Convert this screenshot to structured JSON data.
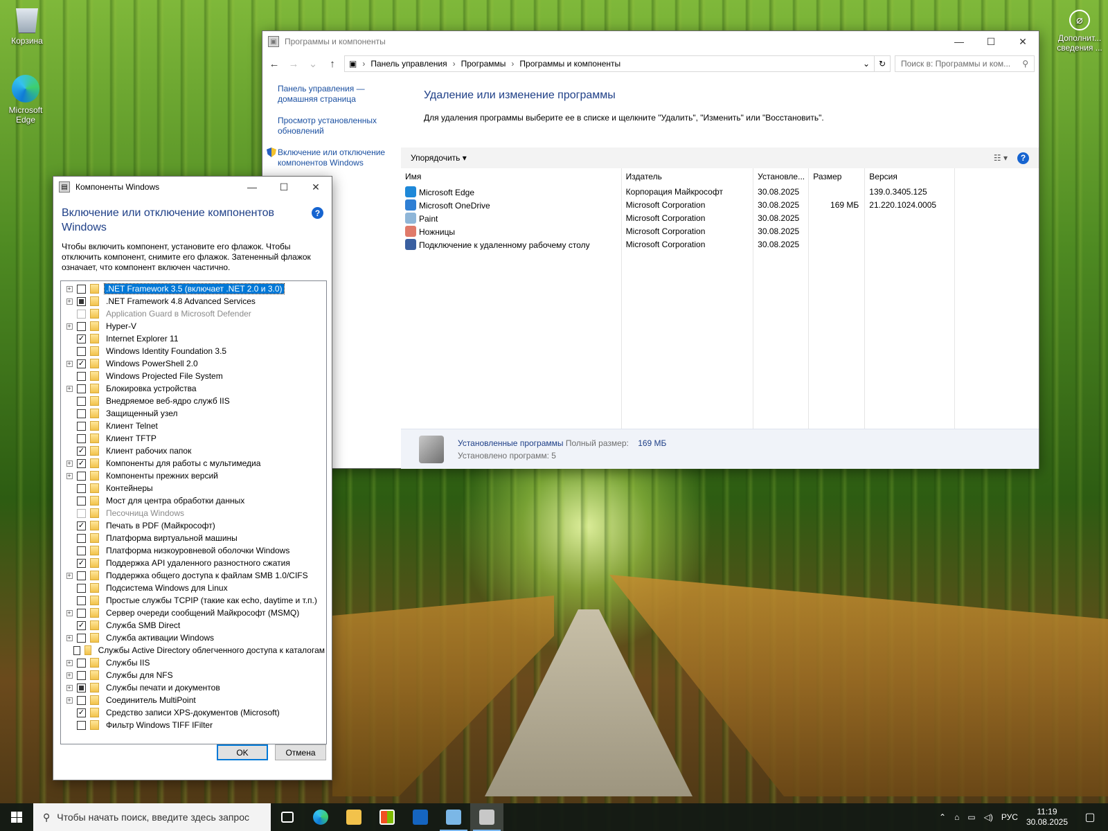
{
  "desktop": {
    "icons": [
      {
        "label": "Корзина",
        "icon": "recycle-bin-icon"
      },
      {
        "label": "Microsoft Edge",
        "icon": "edge-icon"
      }
    ],
    "right_icon": {
      "label": "Дополнит... сведения ..."
    }
  },
  "programs_window": {
    "title": "Программы и компоненты",
    "breadcrumb": [
      "Панель управления",
      "Программы",
      "Программы и компоненты"
    ],
    "search_placeholder": "Поиск в: Программы и ком...",
    "left_links": [
      "Панель управления — домашняя страница",
      "Просмотр установленных обновлений",
      "Включение или отключение компонентов Windows"
    ],
    "heading": "Удаление или изменение программы",
    "description": "Для удаления программы выберите ее в списке и щелкните \"Удалить\", \"Изменить\" или \"Восстановить\".",
    "organize_label": "Упорядочить",
    "columns": [
      "Имя",
      "Издатель",
      "Установле...",
      "Размер",
      "Версия"
    ],
    "programs": [
      {
        "name": "Microsoft Edge",
        "publisher": "Корпорация Майкрософт",
        "installed": "30.08.2025",
        "size": "",
        "version": "139.0.3405.125",
        "icon_color": "#1e88d8"
      },
      {
        "name": "Microsoft OneDrive",
        "publisher": "Microsoft Corporation",
        "installed": "30.08.2025",
        "size": "169 МБ",
        "version": "21.220.1024.0005",
        "icon_color": "#2f7fd4"
      },
      {
        "name": "Paint",
        "publisher": "Microsoft Corporation",
        "installed": "30.08.2025",
        "size": "",
        "version": "",
        "icon_color": "#8fb6d8"
      },
      {
        "name": "Ножницы",
        "publisher": "Microsoft Corporation",
        "installed": "30.08.2025",
        "size": "",
        "version": "",
        "icon_color": "#e07a6a"
      },
      {
        "name": "Подключение к удаленному рабочему столу",
        "publisher": "Microsoft Corporation",
        "installed": "30.08.2025",
        "size": "",
        "version": "",
        "icon_color": "#3a5fa0"
      }
    ],
    "status": {
      "installed_label": "Установленные программы",
      "total_size_label": "Полный размер:",
      "total_size": "169 МБ",
      "count_text": "Установлено программ: 5"
    }
  },
  "components_dialog": {
    "title": "Компоненты Windows",
    "heading": "Включение или отключение компонентов Windows",
    "description": "Чтобы включить компонент, установите его флажок. Чтобы отключить компонент, снимите его флажок. Затененный флажок означает, что компонент включен частично.",
    "items": [
      {
        "label": ".NET Framework 3.5 (включает .NET 2.0 и 3.0)",
        "state": "unchecked",
        "expandable": true,
        "selected": true,
        "disabled": false
      },
      {
        "label": ".NET Framework 4.8 Advanced Services",
        "state": "partial",
        "expandable": true,
        "selected": false,
        "disabled": false
      },
      {
        "label": "Application Guard в Microsoft Defender",
        "state": "unchecked",
        "expandable": false,
        "selected": false,
        "disabled": true
      },
      {
        "label": "Hyper-V",
        "state": "unchecked",
        "expandable": true,
        "selected": false,
        "disabled": false
      },
      {
        "label": "Internet Explorer 11",
        "state": "checked",
        "expandable": false,
        "selected": false,
        "disabled": false
      },
      {
        "label": "Windows Identity Foundation 3.5",
        "state": "unchecked",
        "expandable": false,
        "selected": false,
        "disabled": false
      },
      {
        "label": "Windows PowerShell 2.0",
        "state": "checked",
        "expandable": true,
        "selected": false,
        "disabled": false
      },
      {
        "label": "Windows Projected File System",
        "state": "unchecked",
        "expandable": false,
        "selected": false,
        "disabled": false
      },
      {
        "label": "Блокировка устройства",
        "state": "unchecked",
        "expandable": true,
        "selected": false,
        "disabled": false
      },
      {
        "label": "Внедряемое веб-ядро служб IIS",
        "state": "unchecked",
        "expandable": false,
        "selected": false,
        "disabled": false
      },
      {
        "label": "Защищенный узел",
        "state": "unchecked",
        "expandable": false,
        "selected": false,
        "disabled": false
      },
      {
        "label": "Клиент Telnet",
        "state": "unchecked",
        "expandable": false,
        "selected": false,
        "disabled": false
      },
      {
        "label": "Клиент TFTP",
        "state": "unchecked",
        "expandable": false,
        "selected": false,
        "disabled": false
      },
      {
        "label": "Клиент рабочих папок",
        "state": "checked",
        "expandable": false,
        "selected": false,
        "disabled": false
      },
      {
        "label": "Компоненты для работы с мультимедиа",
        "state": "checked",
        "expandable": true,
        "selected": false,
        "disabled": false
      },
      {
        "label": "Компоненты прежних версий",
        "state": "unchecked",
        "expandable": true,
        "selected": false,
        "disabled": false
      },
      {
        "label": "Контейнеры",
        "state": "unchecked",
        "expandable": false,
        "selected": false,
        "disabled": false
      },
      {
        "label": "Мост для центра обработки данных",
        "state": "unchecked",
        "expandable": false,
        "selected": false,
        "disabled": false
      },
      {
        "label": "Песочница Windows",
        "state": "unchecked",
        "expandable": false,
        "selected": false,
        "disabled": true
      },
      {
        "label": "Печать в PDF (Майкрософт)",
        "state": "checked",
        "expandable": false,
        "selected": false,
        "disabled": false
      },
      {
        "label": "Платформа виртуальной машины",
        "state": "unchecked",
        "expandable": false,
        "selected": false,
        "disabled": false
      },
      {
        "label": "Платформа низкоуровневой оболочки Windows",
        "state": "unchecked",
        "expandable": false,
        "selected": false,
        "disabled": false
      },
      {
        "label": "Поддержка API удаленного разностного сжатия",
        "state": "checked",
        "expandable": false,
        "selected": false,
        "disabled": false
      },
      {
        "label": "Поддержка общего доступа к файлам SMB 1.0/CIFS",
        "state": "unchecked",
        "expandable": true,
        "selected": false,
        "disabled": false
      },
      {
        "label": "Подсистема Windows для Linux",
        "state": "unchecked",
        "expandable": false,
        "selected": false,
        "disabled": false
      },
      {
        "label": "Простые службы TCPIP (такие как echo, daytime и т.п.)",
        "state": "unchecked",
        "expandable": false,
        "selected": false,
        "disabled": false
      },
      {
        "label": "Сервер очереди сообщений Майкрософт (MSMQ)",
        "state": "unchecked",
        "expandable": true,
        "selected": false,
        "disabled": false
      },
      {
        "label": "Служба SMB Direct",
        "state": "checked",
        "expandable": false,
        "selected": false,
        "disabled": false
      },
      {
        "label": "Служба активации Windows",
        "state": "unchecked",
        "expandable": true,
        "selected": false,
        "disabled": false
      },
      {
        "label": "Службы Active Directory облегченного доступа к каталогам",
        "state": "unchecked",
        "expandable": false,
        "selected": false,
        "disabled": false
      },
      {
        "label": "Службы IIS",
        "state": "unchecked",
        "expandable": true,
        "selected": false,
        "disabled": false
      },
      {
        "label": "Службы для NFS",
        "state": "unchecked",
        "expandable": true,
        "selected": false,
        "disabled": false
      },
      {
        "label": "Службы печати и документов",
        "state": "partial",
        "expandable": true,
        "selected": false,
        "disabled": false
      },
      {
        "label": "Соединитель MultiPoint",
        "state": "unchecked",
        "expandable": true,
        "selected": false,
        "disabled": false
      },
      {
        "label": "Средство записи XPS-документов (Microsoft)",
        "state": "checked",
        "expandable": false,
        "selected": false,
        "disabled": false
      },
      {
        "label": "Фильтр Windows TIFF IFilter",
        "state": "unchecked",
        "expandable": false,
        "selected": false,
        "disabled": false
      }
    ],
    "ok_label": "OK",
    "cancel_label": "Отмена"
  },
  "taskbar": {
    "search_placeholder": "Чтобы начать поиск, введите здесь запрос",
    "pinned": [
      {
        "name": "task-view-icon",
        "color": "#ffffff"
      },
      {
        "name": "edge-icon",
        "color": "#1e88d8"
      },
      {
        "name": "file-explorer-icon",
        "color": "#f2c24b"
      },
      {
        "name": "store-icon",
        "color": "#ffffff"
      },
      {
        "name": "outlook-icon",
        "color": "#1565c0"
      },
      {
        "name": "control-panel-icon",
        "color": "#7bb7e6"
      },
      {
        "name": "programs-icon",
        "color": "#c8c8c8"
      }
    ],
    "language": "РУС",
    "time": "11:19",
    "date": "30.08.2025"
  }
}
